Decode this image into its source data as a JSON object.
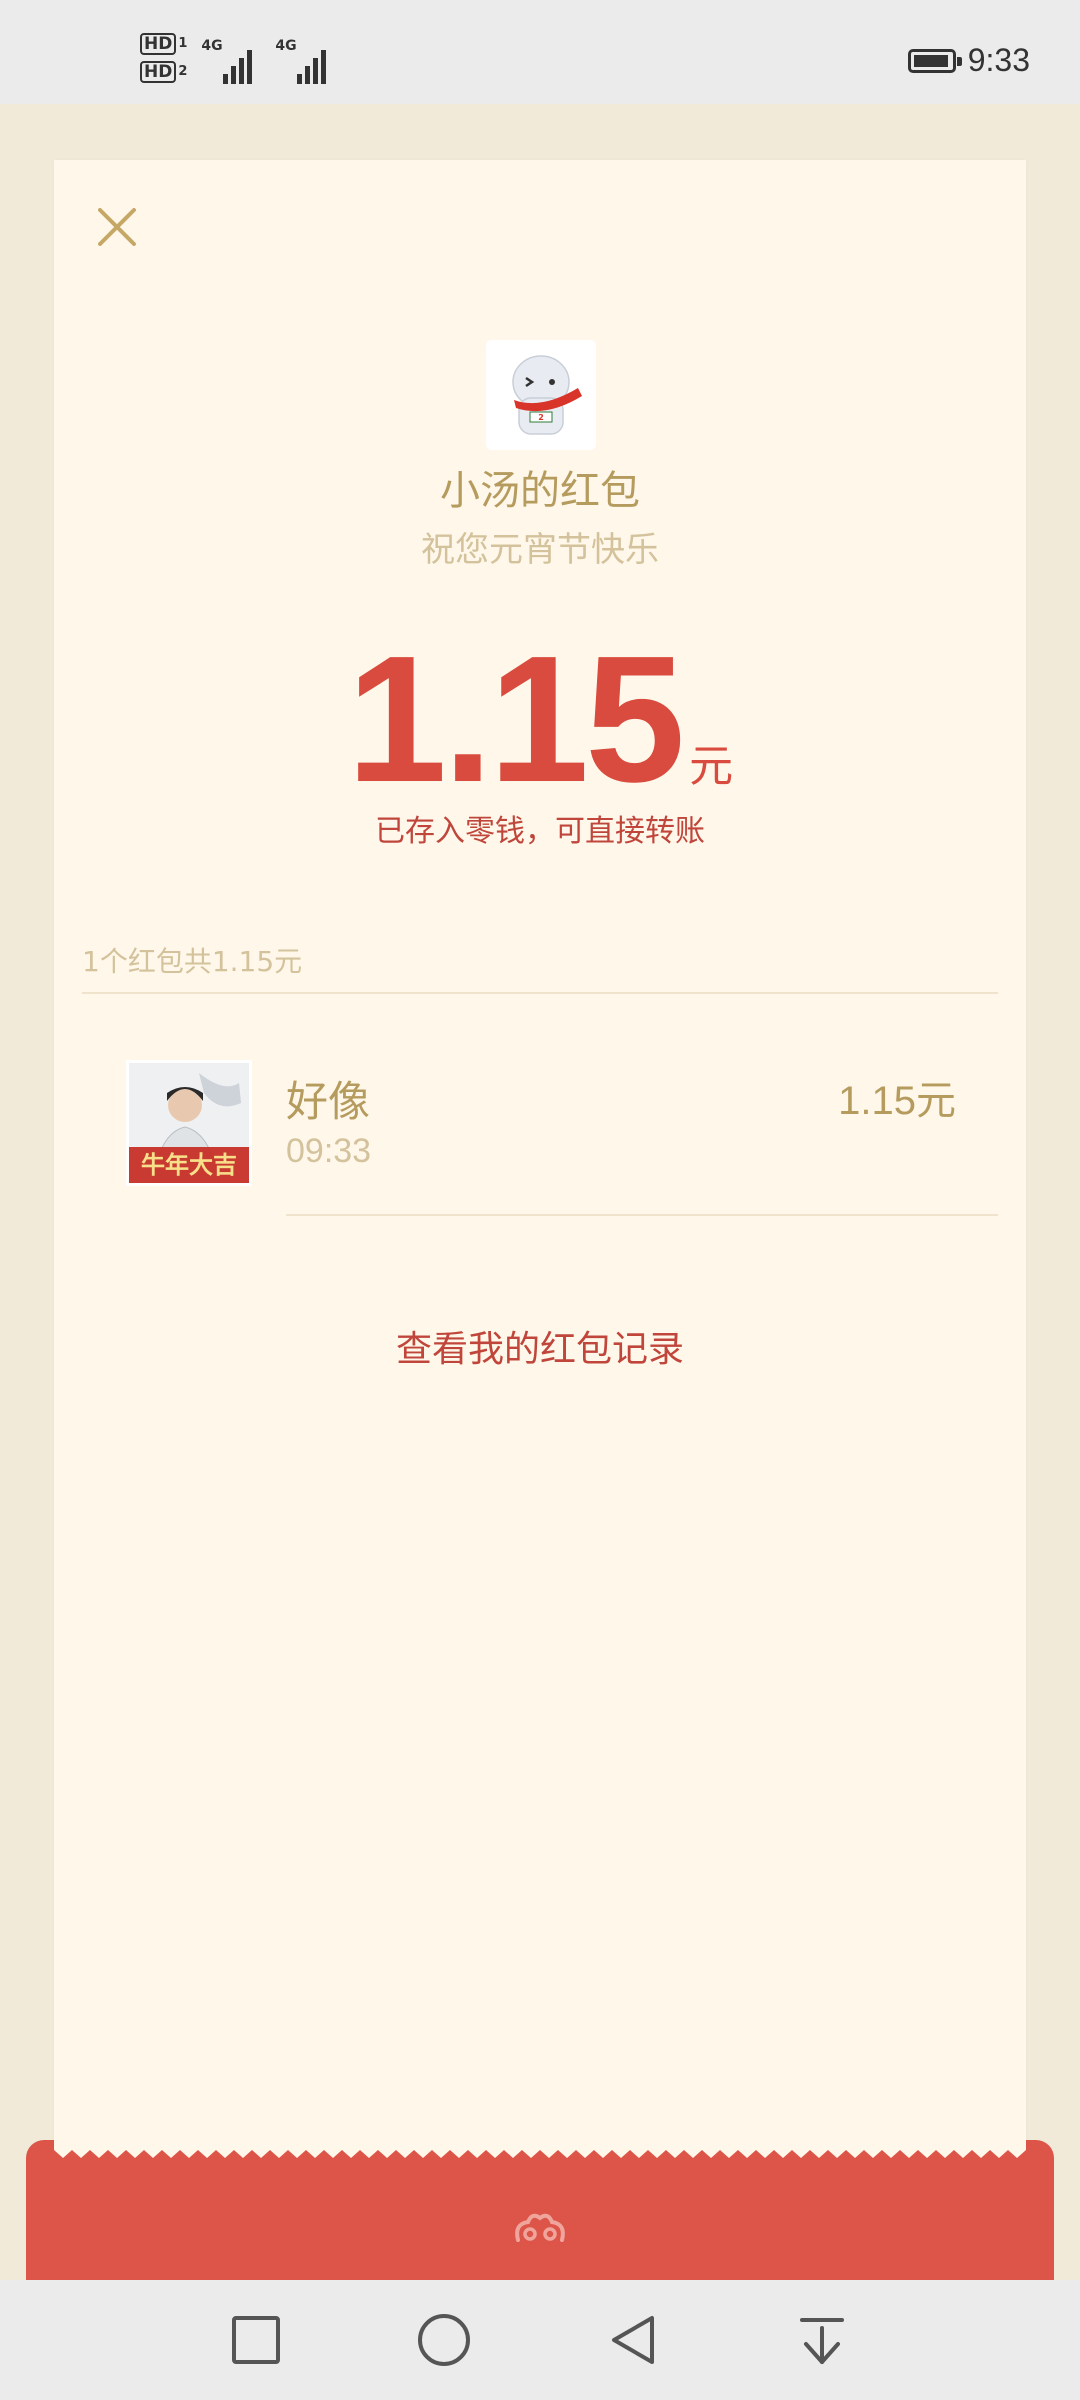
{
  "status_bar": {
    "sim1": "HD",
    "sim1_index": "1",
    "sim2": "HD",
    "sim2_index": "2",
    "net1": "4G",
    "net2": "4G",
    "time": "9:33",
    "battery_icon": "battery-icon"
  },
  "card": {
    "close_icon": "close-icon",
    "sender": "小汤的红包",
    "wish": "祝您元宵节快乐",
    "amount": "1.15",
    "unit": "元",
    "note": "已存入零钱，可直接转账",
    "summary": "1个红包共1.15元",
    "entries": [
      {
        "name": "好像",
        "time": "09:33",
        "amount": "1.15元",
        "avatar_caption": "牛年大吉"
      }
    ],
    "records_link": "查看我的红包记录"
  },
  "colors": {
    "accent_red": "#d94b3e",
    "gold_text": "#b59b5e",
    "muted_text": "#d3c29b",
    "card_bg": "#fff8ea",
    "envelope_red": "#dd5548"
  },
  "nav": {
    "recent_icon": "square-icon",
    "home_icon": "circle-icon",
    "back_icon": "triangle-back-icon",
    "notification_icon": "pull-down-icon"
  }
}
